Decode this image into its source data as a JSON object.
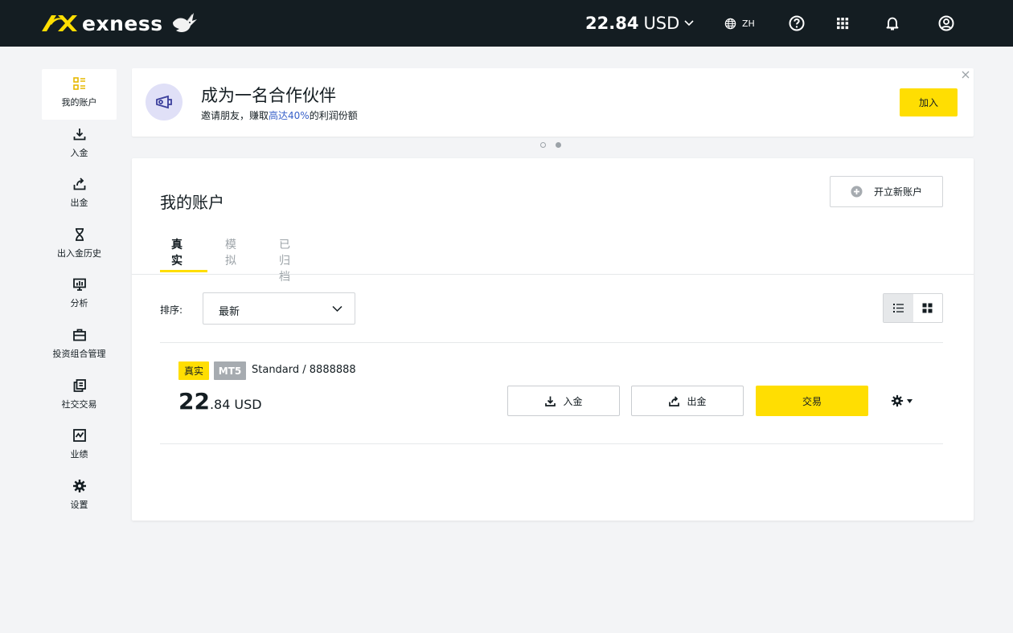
{
  "header": {
    "brand": "exness",
    "balance_amount": "22.84",
    "balance_currency": "USD",
    "language": "ZH"
  },
  "sidebar": {
    "items": [
      {
        "label": "我的账户",
        "icon": "accounts-icon",
        "active": true
      },
      {
        "label": "入金",
        "icon": "deposit-icon"
      },
      {
        "label": "出金",
        "icon": "withdraw-icon"
      },
      {
        "label": "出入金历史",
        "icon": "hourglass-icon"
      },
      {
        "label": "分析",
        "icon": "analytics-icon"
      },
      {
        "label": "投资组合管理",
        "icon": "briefcase-icon"
      },
      {
        "label": "社交交易",
        "icon": "copy-trading-icon"
      },
      {
        "label": "业绩",
        "icon": "performance-icon"
      },
      {
        "label": "设置",
        "icon": "gear-icon"
      }
    ]
  },
  "promo": {
    "title": "成为一名合作伙伴",
    "subtitle_prefix": "邀请朋友，赚取",
    "subtitle_highlight": "高达40%",
    "subtitle_suffix": "的利润份额",
    "join_label": "加入",
    "accent_color": "#3760c9"
  },
  "main": {
    "title": "我的账户",
    "open_account_label": "开立新账户",
    "tabs": [
      {
        "label": "真实",
        "active": true
      },
      {
        "label": "模拟"
      },
      {
        "label": "已归档"
      }
    ],
    "sort_label": "排序:",
    "sort_value": "最新",
    "view_mode": "list"
  },
  "account": {
    "type_badge": "真实",
    "platform_badge": "MT5",
    "name": "Standard / 8888888",
    "balance_int": "22",
    "balance_dec": ".84",
    "currency": "USD",
    "deposit_label": "入金",
    "withdraw_label": "出金",
    "trade_label": "交易"
  },
  "colors": {
    "brand_yellow": "#ffde02",
    "topbar": "#141d22"
  }
}
